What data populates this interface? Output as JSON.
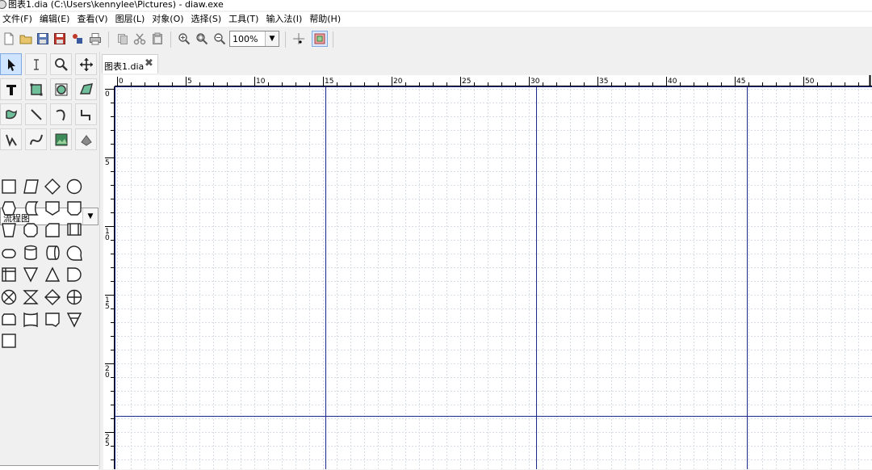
{
  "window": {
    "title": "图表1.dia (C:\\Users\\kennylee\\Pictures) - diaw.exe"
  },
  "menu": [
    {
      "name": "menu-file",
      "label": "文件(F)"
    },
    {
      "name": "menu-edit",
      "label": "编辑(E)"
    },
    {
      "name": "menu-view",
      "label": "查看(V)"
    },
    {
      "name": "menu-layers",
      "label": "图层(L)"
    },
    {
      "name": "menu-objects",
      "label": "对象(O)"
    },
    {
      "name": "menu-select",
      "label": "选择(S)"
    },
    {
      "name": "menu-tools",
      "label": "工具(T)"
    },
    {
      "name": "menu-input",
      "label": "输入法(I)"
    },
    {
      "name": "menu-help",
      "label": "帮助(H)"
    }
  ],
  "toolbar": {
    "icons": [
      "new-icon",
      "open-icon",
      "save-icon",
      "save-as-icon",
      "export-icon",
      "print-icon",
      "copy-icon",
      "cut-icon",
      "paste-icon",
      "zoom-in-icon",
      "zoom-fit-icon",
      "zoom-out-icon"
    ],
    "zoom": "100%",
    "snap_grid_icon": "snap-grid-icon",
    "snap_object_icon": "snap-object-icon"
  },
  "toolbox": {
    "tools": [
      "pointer-icon",
      "text-cursor-icon",
      "magnify-icon",
      "move-icon",
      "text-tool-icon",
      "box-icon",
      "ellipse-icon",
      "polygon-icon",
      "beziergon-icon",
      "line-icon",
      "arc-icon",
      "zigzag-icon",
      "polyline-icon",
      "bezier-icon",
      "image-icon",
      "outline-icon"
    ],
    "sheet": "流程图",
    "shapes": [
      "process-shape",
      "parallelogram-shape",
      "diamond-shape",
      "circle-shape",
      "hexagon-shape",
      "stored-data-shape",
      "offpage-connector-shape",
      "manual-operation-shape",
      "trapezoid-shape",
      "octagon-shape",
      "card-shape",
      "predefined-process-shape",
      "terminal-shape",
      "disk-storage-shape",
      "direct-data-shape",
      "sequential-data-shape",
      "internal-storage-shape",
      "merge-shape",
      "extract-shape",
      "delay-shape",
      "summing-junction-shape",
      "collate-shape",
      "sort-shape",
      "or-shape",
      "punched-tape-shape",
      "document-shape",
      "display-shape",
      "offline-storage-shape",
      "transaction-file-shape"
    ]
  },
  "tabs": [
    {
      "label": "图表1.dia",
      "close_icon": "close-icon"
    }
  ],
  "ruler": {
    "h_labels": [
      "0",
      "5",
      "10",
      "15",
      "20",
      "25",
      "30",
      "35",
      "40",
      "45",
      "50"
    ],
    "v_labels": [
      "0",
      "5",
      "10",
      "15",
      "20",
      "25"
    ]
  },
  "colors": {
    "guide": "#1c2a8c",
    "grid": "#d8dee8",
    "accent": "#2b6cc4"
  }
}
